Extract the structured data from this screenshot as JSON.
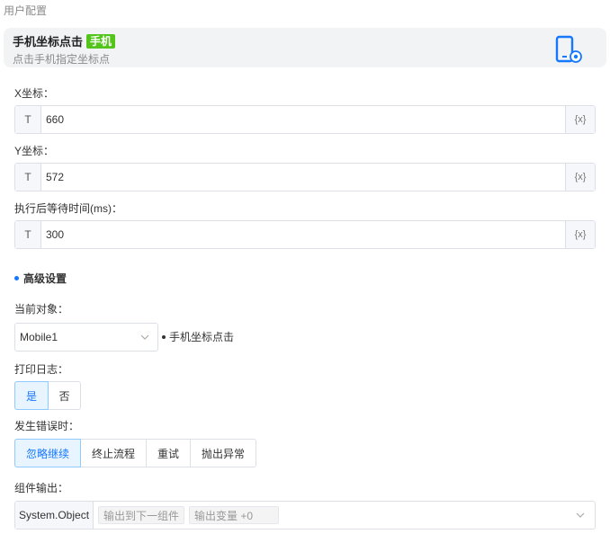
{
  "page": {
    "title": "用户配置"
  },
  "header": {
    "title": "手机坐标点击",
    "badge": "手机",
    "subtitle": "点击手机指定坐标点",
    "icon": "mobile-settings-icon",
    "accent": "#1677ff",
    "badge_color": "#52c41a"
  },
  "fields": [
    {
      "label": "X坐标：",
      "prefix": "T",
      "value": "660",
      "suffix": "{x}"
    },
    {
      "label": "Y坐标：",
      "prefix": "T",
      "value": "572",
      "suffix": "{x}"
    },
    {
      "label": "执行后等待时间(ms)：",
      "prefix": "T",
      "value": "300",
      "suffix": "{x}"
    }
  ],
  "advanced": {
    "title": "高级设置",
    "current_object": {
      "label": "当前对象：",
      "value": "Mobile1",
      "note": "手机坐标点击"
    },
    "print_log": {
      "label": "打印日志：",
      "options": [
        "是",
        "否"
      ],
      "selected": "是"
    },
    "on_error": {
      "label": "发生错误时：",
      "options": [
        "忽略继续",
        "终止流程",
        "重试",
        "抛出异常"
      ],
      "selected": "忽略继续"
    },
    "output": {
      "label": "组件输出：",
      "type": "System.Object",
      "tags": [
        "输出到下一组件",
        "输出变量 +0"
      ]
    }
  }
}
